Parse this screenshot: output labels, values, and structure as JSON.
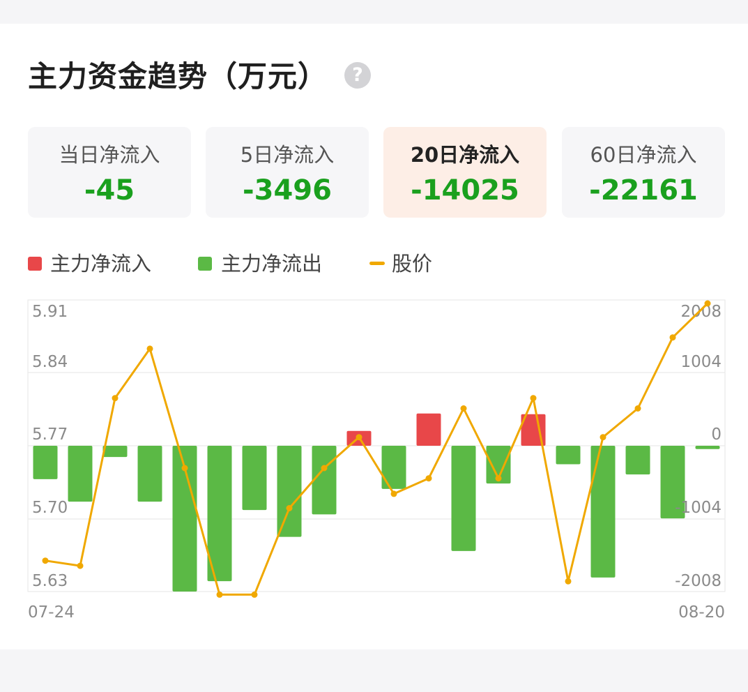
{
  "header": {
    "title": "主力资金趋势（万元）",
    "help_icon": "question-circle-icon"
  },
  "tabs": [
    {
      "label": "当日净流入",
      "value": "-45",
      "active": false
    },
    {
      "label": "5日净流入",
      "value": "-3496",
      "active": false
    },
    {
      "label": "20日净流入",
      "value": "-14025",
      "active": true
    },
    {
      "label": "60日净流入",
      "value": "-22161",
      "active": false
    }
  ],
  "legend": [
    {
      "label": "主力净流入",
      "color": "#e84749"
    },
    {
      "label": "主力净流出",
      "color": "#5bb945"
    },
    {
      "label": "股价",
      "color": "#f0a800"
    }
  ],
  "colors": {
    "positive": "#e84749",
    "negative": "#5bb945",
    "price_line": "#f0a800",
    "value_text": "#1aa01e",
    "active_tab_bg": "#fdeee6"
  },
  "chart_data": {
    "type": "bar",
    "x_start_label": "07-24",
    "x_end_label": "08-20",
    "left_axis_ticks": [
      "5.91",
      "5.84",
      "5.77",
      "5.70",
      "5.63"
    ],
    "right_axis_ticks": [
      "2008",
      "1004",
      "0",
      "-1004",
      "-2008"
    ],
    "left_ylim": [
      5.63,
      5.91
    ],
    "right_ylim": [
      -2008,
      2008
    ],
    "series": [
      {
        "name": "主力净流入",
        "type": "bar",
        "values": [
          -460,
          -770,
          -155,
          -770,
          -2008,
          -1865,
          -885,
          -1255,
          -945,
          205,
          -595,
          445,
          -1450,
          -520,
          435,
          -255,
          -1815,
          -395,
          -1000,
          -45
        ]
      },
      {
        "name": "股价",
        "type": "line",
        "values": [
          5.66,
          5.655,
          5.818,
          5.866,
          5.75,
          5.627,
          5.627,
          5.711,
          5.75,
          5.78,
          5.725,
          5.74,
          5.808,
          5.74,
          5.818,
          5.64,
          5.78,
          5.808,
          5.877,
          5.91
        ]
      }
    ],
    "grid": true,
    "legend_position": "top-left"
  }
}
